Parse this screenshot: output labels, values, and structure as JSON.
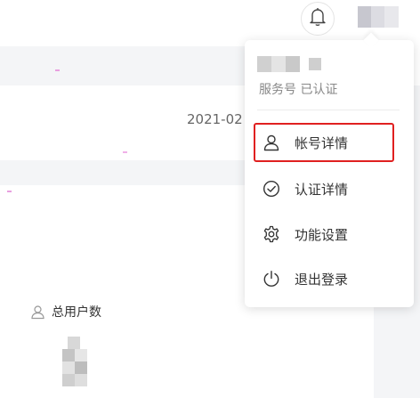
{
  "header": {
    "bell_icon": "bell-icon",
    "avatar": "blurred-avatar"
  },
  "background": {
    "date_text": "2021-02",
    "stats": {
      "total_users_label": "总用户数",
      "total_users_icon": "user-icon"
    }
  },
  "user_menu": {
    "user_name_blurred": true,
    "account_status": "服务号  已认证",
    "items": [
      {
        "label": "帐号详情",
        "icon": "user-icon",
        "highlighted": true
      },
      {
        "label": "认证详情",
        "icon": "check-circle-icon",
        "highlighted": false
      },
      {
        "label": "功能设置",
        "icon": "gear-icon",
        "highlighted": false
      },
      {
        "label": "退出登录",
        "icon": "power-icon",
        "highlighted": false
      }
    ]
  },
  "colors": {
    "highlight_border": "#e02020",
    "page_band": "#f4f5f7",
    "text": "#333333",
    "muted_text": "#888888"
  }
}
